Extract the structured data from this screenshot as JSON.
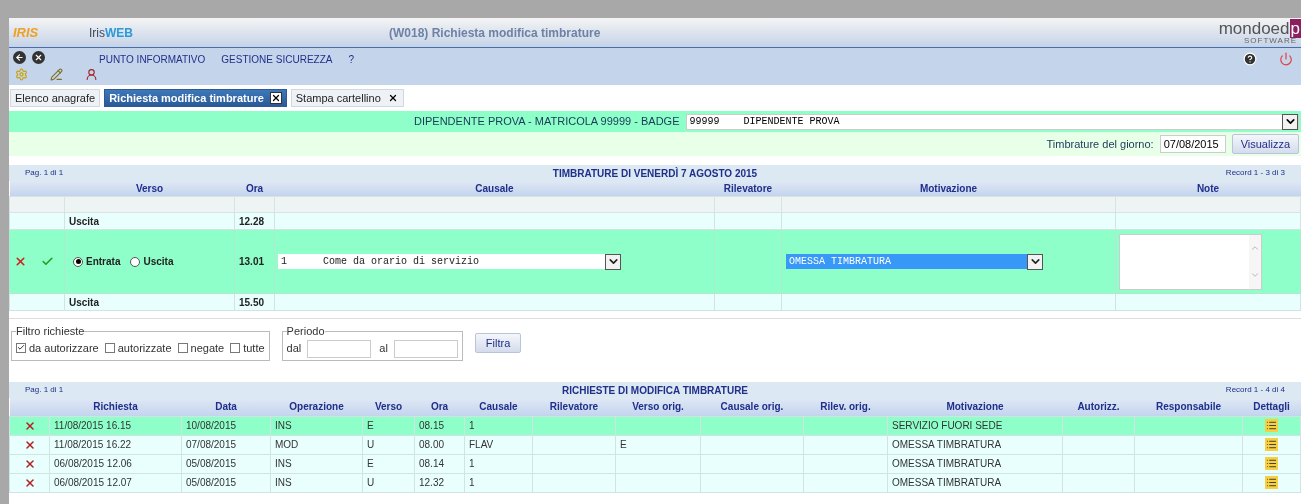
{
  "header": {
    "logo": "IRIS",
    "app_name": "Iris",
    "app_name_accent": "WEB",
    "window_title": "(W018) Richiesta modifica timbrature",
    "brand": "mondoed",
    "brand_mark": "p",
    "brand_sub": "SOFTWARE"
  },
  "menu": [
    "PUNTO INFORMATIVO",
    "GESTIONE SICUREZZA",
    "?"
  ],
  "tabs": [
    {
      "label": "Elenco anagrafe",
      "selected": false,
      "closable": false
    },
    {
      "label": "Richiesta modifica timbrature",
      "selected": true,
      "closable": true
    },
    {
      "label": "Stampa cartellino",
      "selected": false,
      "closable": true
    }
  ],
  "employee": {
    "label": "DIPENDENTE PROVA - MATRICOLA 99999 - BADGE",
    "value": "99999    DIPENDENTE PROVA"
  },
  "day": {
    "label": "Timbrature del giorno:",
    "value": "07/08/2015",
    "button": "Visualizza"
  },
  "punches": {
    "pager": "Pag. 1 di 1",
    "title": "TIMBRATURE DI VENERDÌ 7 AGOSTO 2015",
    "record": "Record 1 - 3 di 3",
    "columns": [
      "Verso",
      "Ora",
      "Causale",
      "Rilevatore",
      "Motivazione",
      "Note"
    ],
    "rows": [
      {
        "kind": "view",
        "verso": "Uscita",
        "ora": "12.28"
      },
      {
        "kind": "edit",
        "directions": [
          {
            "label": "Entrata",
            "selected": true
          },
          {
            "label": "Uscita",
            "selected": false
          }
        ],
        "ora": "13.01",
        "causale": "1      Come da orario di servizio",
        "motivazione": "OMESSA TIMBRATURA"
      },
      {
        "kind": "view",
        "verso": "Uscita",
        "ora": "15.50"
      }
    ]
  },
  "filter": {
    "legend": "Filtro richieste",
    "options": [
      {
        "label": "da autorizzare",
        "checked": true
      },
      {
        "label": "autorizzate",
        "checked": false
      },
      {
        "label": "negate",
        "checked": false
      },
      {
        "label": "tutte",
        "checked": false
      }
    ],
    "period_legend": "Periodo",
    "from_label": "dal",
    "to_label": "al",
    "button": "Filtra"
  },
  "requests": {
    "pager": "Pag. 1 di 1",
    "title": "RICHIESTE DI MODIFICA TIMBRATURE",
    "record": "Record 1 - 4 di 4",
    "columns": [
      "Richiesta",
      "Data",
      "Operazione",
      "Verso",
      "Ora",
      "Causale",
      "Rilevatore",
      "Verso orig.",
      "Causale orig.",
      "Rilev. orig.",
      "Motivazione",
      "Autorizz.",
      "Responsabile",
      "Dettagli"
    ],
    "rows": [
      {
        "selected": true,
        "cells": [
          "11/08/2015 16.15",
          "10/08/2015",
          "INS",
          "E",
          "08.15",
          "1",
          "",
          "",
          "",
          "",
          "SERVIZIO FUORI SEDE",
          "",
          ""
        ]
      },
      {
        "selected": false,
        "cells": [
          "11/08/2015 16.22",
          "07/08/2015",
          "MOD",
          "U",
          "08.00",
          "FLAV",
          "",
          "E",
          "",
          "",
          "OMESSA TIMBRATURA",
          "",
          ""
        ]
      },
      {
        "selected": false,
        "cells": [
          "06/08/2015 12.06",
          "05/08/2015",
          "INS",
          "E",
          "08.14",
          "1",
          "",
          "",
          "",
          "",
          "OMESSA TIMBRATURA",
          "",
          ""
        ]
      },
      {
        "selected": false,
        "cells": [
          "06/08/2015 12.07",
          "05/08/2015",
          "INS",
          "U",
          "12.32",
          "1",
          "",
          "",
          "",
          "",
          "OMESSA TIMBRATURA",
          "",
          ""
        ]
      }
    ]
  }
}
